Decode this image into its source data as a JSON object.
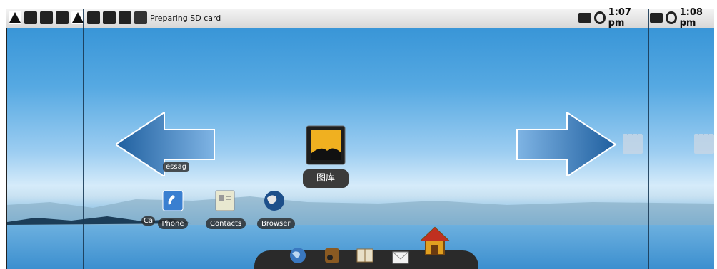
{
  "status_bar": {
    "notification_text": "Preparing SD card",
    "time_primary": "1:07 pm",
    "time_secondary": "1:08 pm"
  },
  "workspace": {
    "left_arrow": "arrow-left",
    "right_arrow": "arrow-right",
    "messaging_label": "essag",
    "call_log_label": "Ca",
    "shortcuts": [
      {
        "label": "Phone"
      },
      {
        "label": "Contacts"
      },
      {
        "label": "Browser"
      }
    ],
    "gallery_label": "图库"
  },
  "colors": {
    "sky": "#4aa3df",
    "statusbar": "#e4e4e4",
    "arrow": "#2d74b8",
    "dock": "#2a2a2a"
  }
}
